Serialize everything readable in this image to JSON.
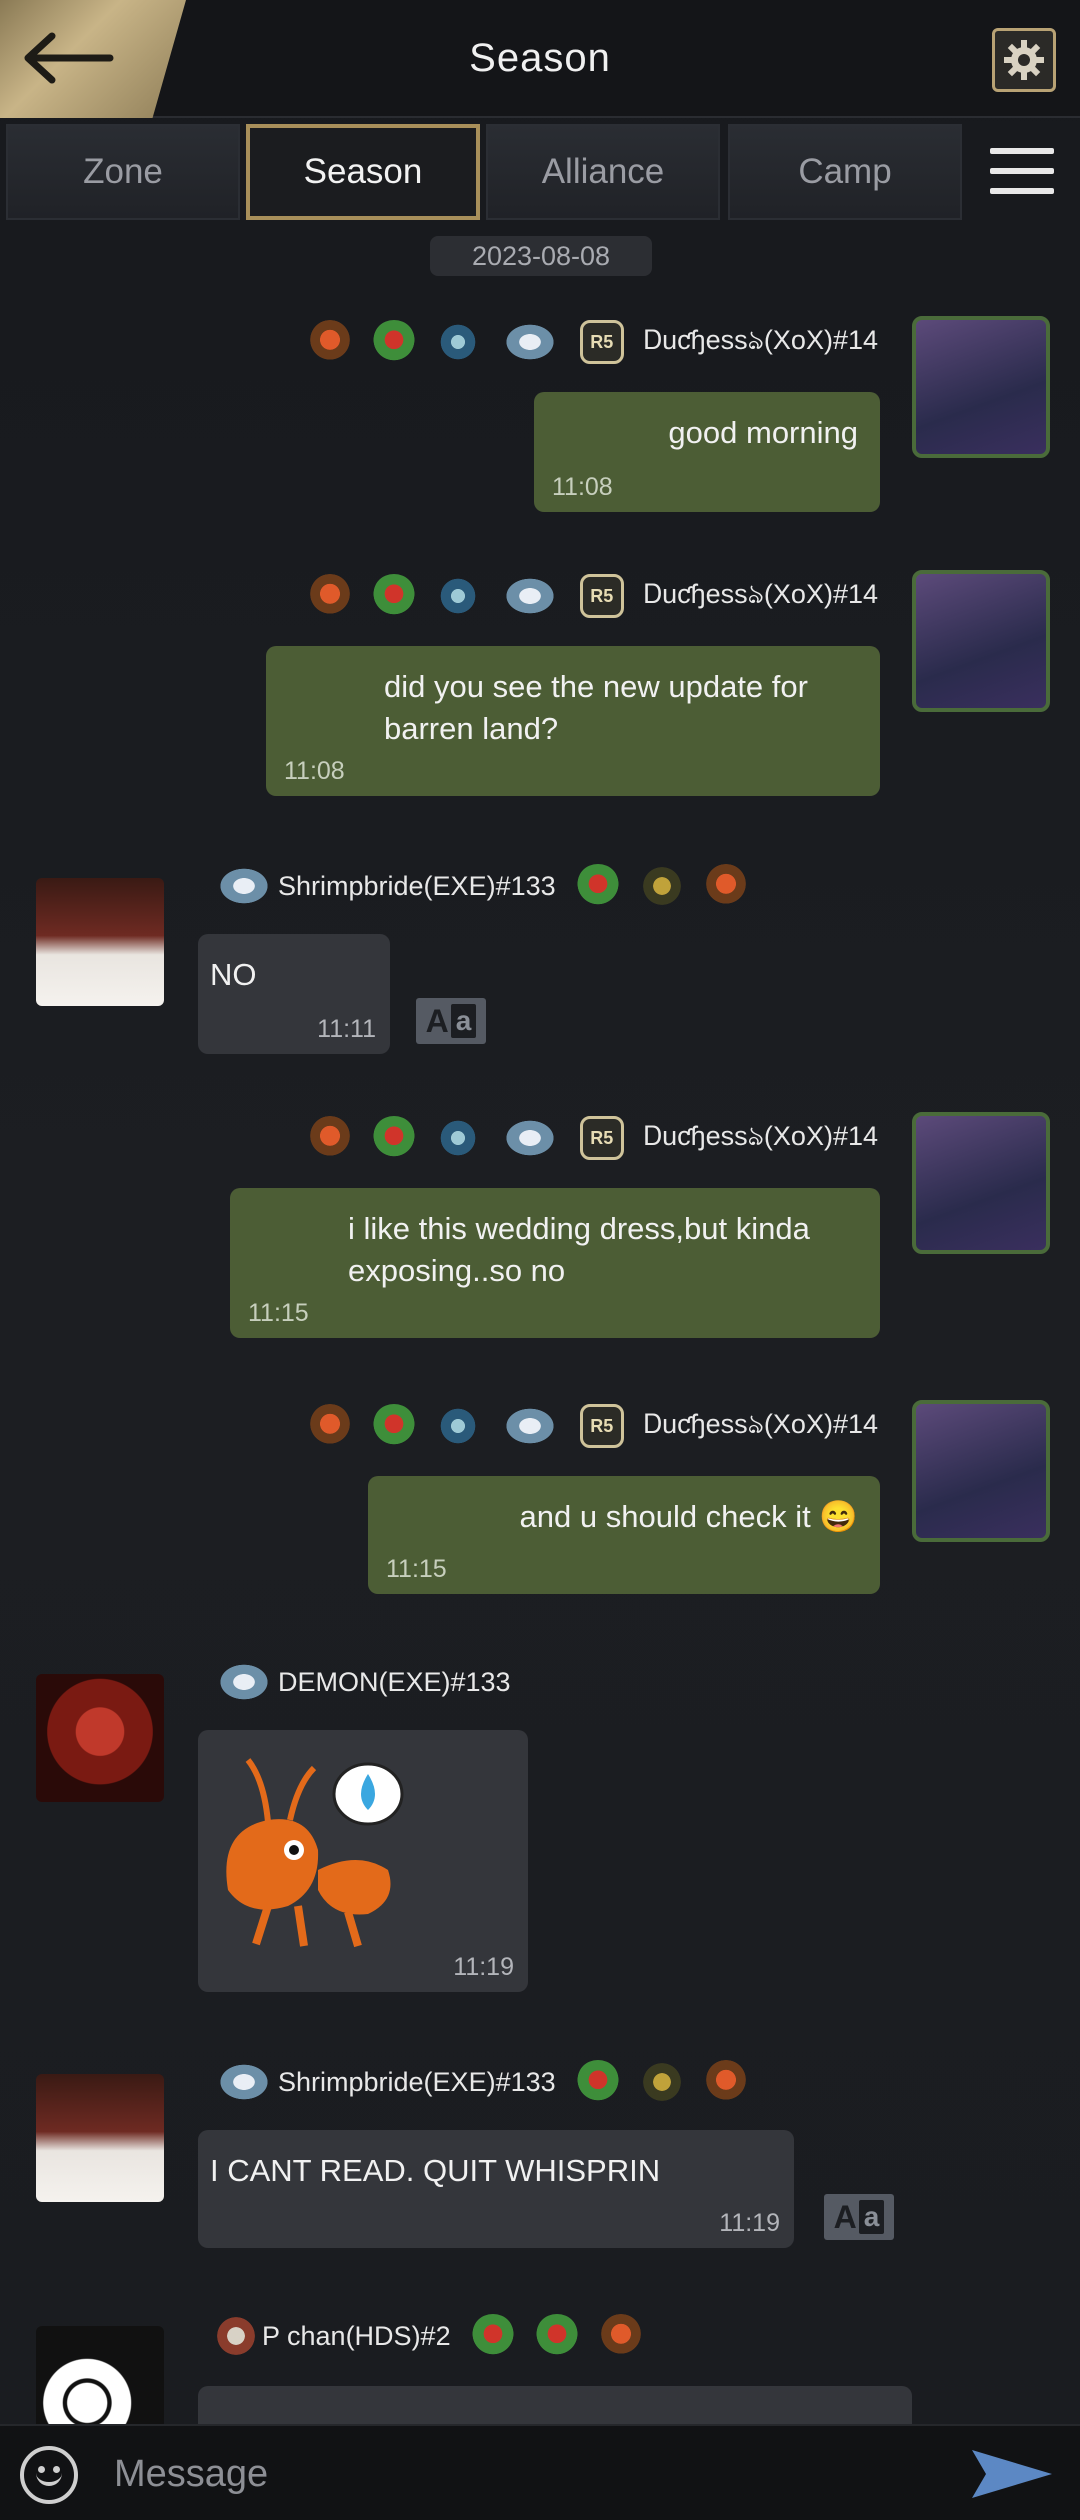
{
  "header": {
    "title": "Season",
    "back_icon": "back-arrow-icon",
    "settings_icon": "gear-icon"
  },
  "tabs": [
    {
      "label": "Zone",
      "active": false
    },
    {
      "label": "Season",
      "active": true
    },
    {
      "label": "Alliance",
      "active": false
    },
    {
      "label": "Camp",
      "active": false
    }
  ],
  "menu_icon": "list-menu-icon",
  "date_divider": "2023-08-08",
  "messages": [
    {
      "author": "Ꭰuƈɧessঌ(XoX)#14",
      "rank": "R5",
      "text": "good morning",
      "time": "11:08",
      "mine": true
    },
    {
      "author": "Ꭰuƈɧessঌ(XoX)#14",
      "rank": "R5",
      "text": "did you see the new update  for barren land?",
      "time": "11:08",
      "mine": true
    },
    {
      "author": "Shrimpbride(EXE)#133",
      "text": "NO",
      "time": "11:11",
      "mine": false,
      "translate": {
        "big": "A",
        "small": "a"
      }
    },
    {
      "author": "Ꭰuƈɧessঌ(XoX)#14",
      "rank": "R5",
      "text": "i like this wedding dress,but kinda exposing..so no",
      "time": "11:15",
      "mine": true
    },
    {
      "author": "Ꭰuƈɧessঌ(XoX)#14",
      "rank": "R5",
      "text": "and u should check it 😄",
      "time": "11:15",
      "mine": true
    },
    {
      "author": "DEMON(EXE)#133",
      "text": "",
      "time": "11:19",
      "mine": false,
      "sticker": "ant-sweat-sticker"
    },
    {
      "author": "Shrimpbride(EXE)#133",
      "text": "I CANT READ. QUIT WHISPRIN",
      "time": "11:19",
      "mine": false,
      "translate": {
        "big": "A",
        "small": "a"
      }
    },
    {
      "author": "P chan(HDS)#2",
      "text": "",
      "time": "",
      "mine": false
    }
  ],
  "composer": {
    "placeholder": "Message",
    "emoji_icon": "smiley-icon",
    "send_icon": "send-icon"
  },
  "colors": {
    "accent_gold": "#a88f5a",
    "my_bubble": "#4c5d35",
    "other_bubble": "#34363b",
    "background": "#1a1c20"
  }
}
